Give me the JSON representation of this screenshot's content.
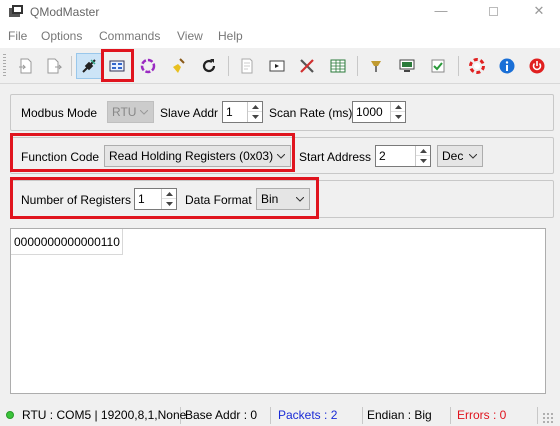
{
  "window": {
    "title": "QModMaster",
    "min_glyph": "—",
    "close_glyph": "✕"
  },
  "menu": [
    "File",
    "Options",
    "Commands",
    "View",
    "Help"
  ],
  "toolbar": {
    "icons": [
      "load-session-icon",
      "save-session-icon",
      "connect-icon",
      "read-write-icon",
      "scan-icon",
      "clear-icon",
      "reset-icon",
      "log-icon",
      "serial-monitor-icon",
      "tools-icon",
      "register-table-icon",
      "bus-monitor-icon",
      "modbus-rtu-icon",
      "modbus-tcp-icon",
      "help-icon",
      "about-icon",
      "exit-icon"
    ],
    "highlight_color": "#e0141e"
  },
  "modbus": {
    "mode_label": "Modbus Mode",
    "mode_value": "RTU",
    "slave_label": "Slave Addr",
    "slave_value": "1",
    "scan_label": "Scan Rate (ms)",
    "scan_value": "1000"
  },
  "function": {
    "label": "Function Code",
    "value": "Read Holding Registers (0x03)",
    "start_label": "Start Address",
    "start_value": "2",
    "base_value": "Dec"
  },
  "registers": {
    "count_label": "Number of Registers",
    "count_value": "1",
    "format_label": "Data Format",
    "format_value": "Bin"
  },
  "results": {
    "cells": [
      "0000000000000110"
    ]
  },
  "status": {
    "connection": "RTU : COM5 | 19200,8,1,None",
    "base_addr": "Base Addr : 0",
    "packets": "Packets : 2",
    "endian": "Endian : Big",
    "errors": "Errors : 0",
    "led_color": "#3bc43b",
    "packets_color": "#1a2bd6",
    "errors_color": "#e0141e"
  }
}
